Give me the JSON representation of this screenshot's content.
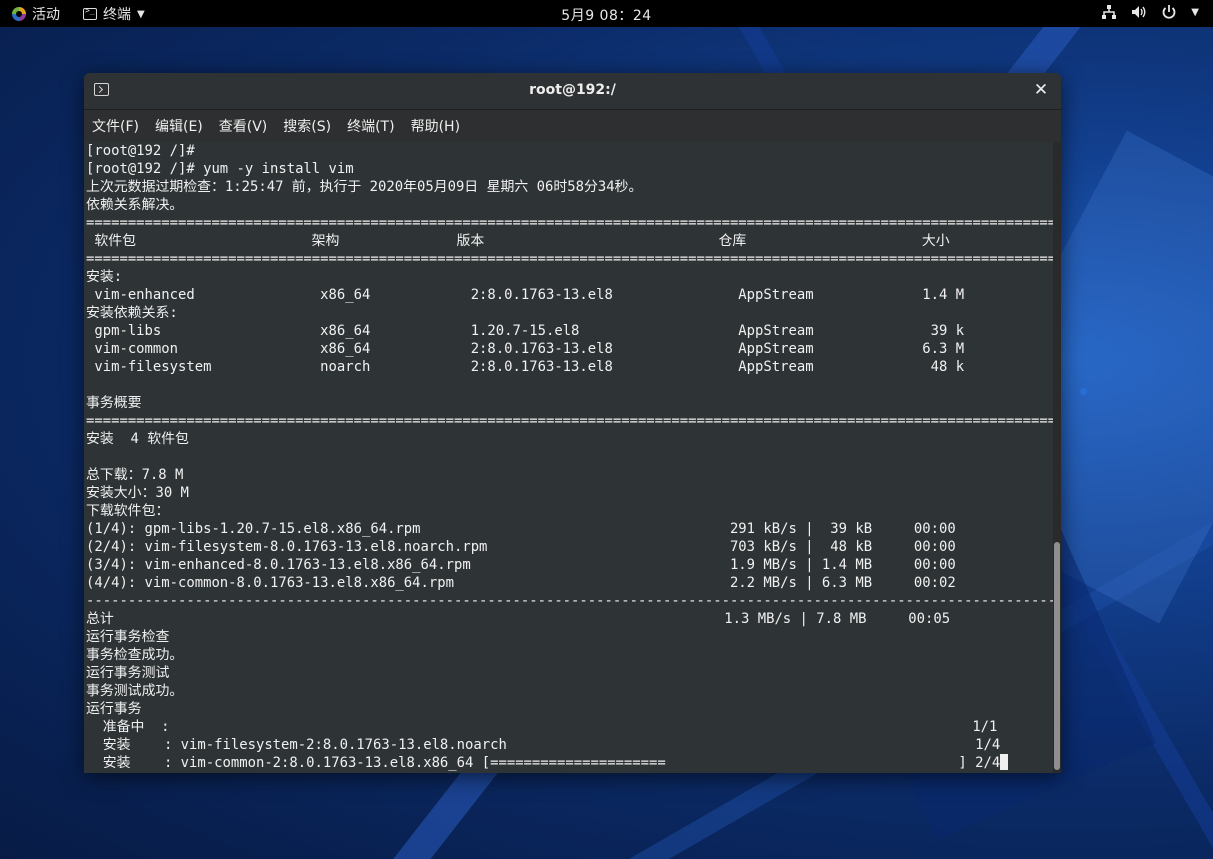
{
  "topbar": {
    "activities_label": "活动",
    "app_label": "终端",
    "clock": "5月9 08：24",
    "icons": [
      "network-icon",
      "volume-icon",
      "power-icon"
    ]
  },
  "window": {
    "title": "root@192:/",
    "close_glyph": "✕",
    "menu": [
      {
        "label": "文件(F)"
      },
      {
        "label": "编辑(E)"
      },
      {
        "label": "查看(V)"
      },
      {
        "label": "搜索(S)"
      },
      {
        "label": "终端(T)"
      },
      {
        "label": "帮助(H)"
      }
    ]
  },
  "terminal": {
    "lines": [
      "[root@192 /]#",
      "[root@192 /]# yum -y install vim",
      "上次元数据过期检查：1:25:47 前，执行于 2020年05月09日 星期六 06时58分34秒。",
      "依赖关系解决。",
      "=====================================================================================================================",
      " 软件包                     架构              版本                            仓库                     大小",
      "=====================================================================================================================",
      "安装:",
      " vim-enhanced               x86_64            2:8.0.1763-13.el8               AppStream             1.4 M",
      "安装依赖关系:",
      " gpm-libs                   x86_64            1.20.7-15.el8                   AppStream              39 k",
      " vim-common                 x86_64            2:8.0.1763-13.el8               AppStream             6.3 M",
      " vim-filesystem             noarch            2:8.0.1763-13.el8               AppStream              48 k",
      "",
      "事务概要",
      "=====================================================================================================================",
      "安装  4 软件包",
      "",
      "总下载：7.8 M",
      "安装大小：30 M",
      "下载软件包：",
      "(1/4): gpm-libs-1.20.7-15.el8.x86_64.rpm                                     291 kB/s |  39 kB     00:00",
      "(2/4): vim-filesystem-8.0.1763-13.el8.noarch.rpm                             703 kB/s |  48 kB     00:00",
      "(3/4): vim-enhanced-8.0.1763-13.el8.x86_64.rpm                               1.9 MB/s | 1.4 MB     00:00",
      "(4/4): vim-common-8.0.1763-13.el8.x86_64.rpm                                 2.2 MB/s | 6.3 MB     00:02",
      "---------------------------------------------------------------------------------------------------------------------",
      "总计                                                                         1.3 MB/s | 7.8 MB     00:05",
      "运行事务检查",
      "事务检查成功。",
      "运行事务测试",
      "事务测试成功。",
      "运行事务",
      "  准备中  :                                                                                                1/1",
      "  安装    : vim-filesystem-2:8.0.1763-13.el8.noarch                                                        1/4",
      "  安装    : vim-common-2:8.0.1763-13.el8.x86_64 [=====================                                   ] 2/4"
    ]
  }
}
